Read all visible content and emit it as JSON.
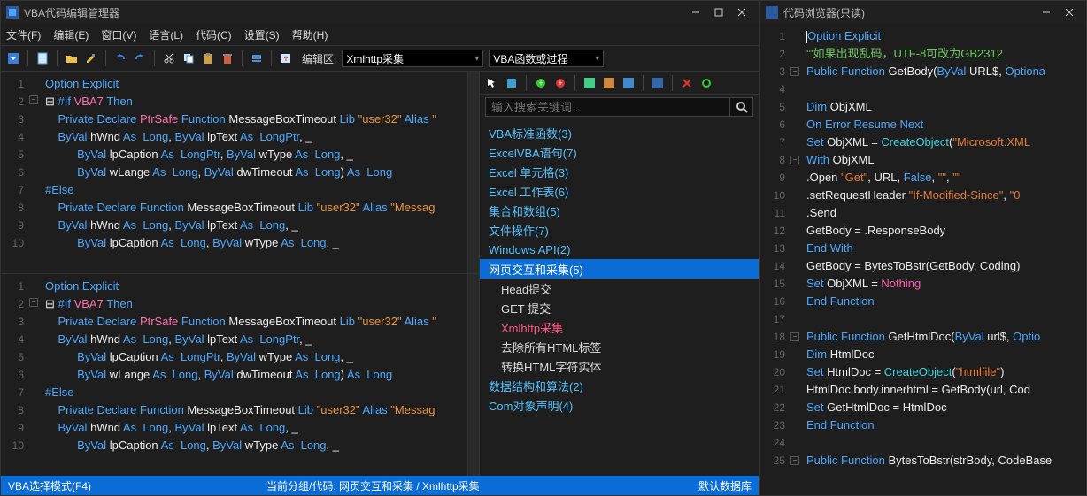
{
  "left": {
    "title": "VBA代码编辑管理器",
    "menu": [
      "文件(F)",
      "编辑(E)",
      "窗口(V)",
      "语言(L)",
      "代码(C)",
      "设置(S)",
      "帮助(H)"
    ],
    "tb_label_area": "编辑区:",
    "combo1": "Xmlhttp采集",
    "combo2": "VBA函数或过程",
    "status_left": "VBA选择模式(F4)",
    "status_mid": "当前分组/代码:  网页交互和采集  /  Xmlhttp采集",
    "status_right": "默认数据库"
  },
  "panel": {
    "search_placeholder": "输入搜索关键词...",
    "tree": [
      {
        "label": "VBA标准函数(3)",
        "sel": false,
        "child": false
      },
      {
        "label": "ExcelVBA语句(7)",
        "sel": false,
        "child": false
      },
      {
        "label": "Excel 单元格(3)",
        "sel": false,
        "child": false
      },
      {
        "label": "Excel 工作表(6)",
        "sel": false,
        "child": false
      },
      {
        "label": "集合和数组(5)",
        "sel": false,
        "child": false
      },
      {
        "label": "文件操作(7)",
        "sel": false,
        "child": false
      },
      {
        "label": "Windows API(2)",
        "sel": false,
        "child": false
      },
      {
        "label": "网页交互和采集(5)",
        "sel": "blue",
        "child": false
      },
      {
        "label": "Head提交",
        "sel": false,
        "child": true
      },
      {
        "label": "GET 提交",
        "sel": false,
        "child": true
      },
      {
        "label": "Xmlhttp采集",
        "sel": "red",
        "child": true
      },
      {
        "label": "去除所有HTML标签",
        "sel": false,
        "child": true
      },
      {
        "label": "转换HTML字符实体",
        "sel": false,
        "child": true
      },
      {
        "label": "数据结构和算法(2)",
        "sel": false,
        "child": false
      },
      {
        "label": "Com对象声明(4)",
        "sel": false,
        "child": false
      }
    ]
  },
  "editor": {
    "gutter": [
      "1",
      "2",
      "3",
      "4",
      "5",
      "6",
      "7",
      "8",
      "9",
      "10"
    ],
    "lines": [
      [
        {
          "t": "Option Explicit",
          "c": "kw-blue"
        }
      ],
      [
        {
          "t": "⊟ ",
          "c": "id"
        },
        {
          "t": "#If ",
          "c": "kw-blue"
        },
        {
          "t": "VBA7 ",
          "c": "kw-pink"
        },
        {
          "t": "Then",
          "c": "kw-blue"
        }
      ],
      [
        {
          "t": "    ",
          "c": ""
        },
        {
          "t": "Private Declare ",
          "c": "kw-blue"
        },
        {
          "t": "PtrSafe ",
          "c": "kw-pink"
        },
        {
          "t": "Function ",
          "c": "kw-blue"
        },
        {
          "t": "MessageBoxTimeout ",
          "c": "id"
        },
        {
          "t": "Lib ",
          "c": "kw-blue"
        },
        {
          "t": "\"user32\" ",
          "c": "kw-orange"
        },
        {
          "t": "Alias ",
          "c": "kw-blue"
        },
        {
          "t": "\"",
          "c": "kw-orange"
        }
      ],
      [
        {
          "t": "    ",
          "c": ""
        },
        {
          "t": "ByVal ",
          "c": "kw-blue"
        },
        {
          "t": "hWnd ",
          "c": "id"
        },
        {
          "t": "As  Long",
          "c": "kw-blue"
        },
        {
          "t": ", ",
          "c": "id"
        },
        {
          "t": "ByVal ",
          "c": "kw-blue"
        },
        {
          "t": "lpText ",
          "c": "id"
        },
        {
          "t": "As  LongPtr",
          "c": "kw-blue"
        },
        {
          "t": ", _",
          "c": "id"
        }
      ],
      [
        {
          "t": "          ",
          "c": ""
        },
        {
          "t": "ByVal ",
          "c": "kw-blue"
        },
        {
          "t": "lpCaption ",
          "c": "id"
        },
        {
          "t": "As  LongPtr",
          "c": "kw-blue"
        },
        {
          "t": ", ",
          "c": "id"
        },
        {
          "t": "ByVal ",
          "c": "kw-blue"
        },
        {
          "t": "wType ",
          "c": "id"
        },
        {
          "t": "As  Long",
          "c": "kw-blue"
        },
        {
          "t": ", _",
          "c": "id"
        }
      ],
      [
        {
          "t": "          ",
          "c": ""
        },
        {
          "t": "ByVal ",
          "c": "kw-blue"
        },
        {
          "t": "wLange ",
          "c": "id"
        },
        {
          "t": "As  Long",
          "c": "kw-blue"
        },
        {
          "t": ", ",
          "c": "id"
        },
        {
          "t": "ByVal ",
          "c": "kw-blue"
        },
        {
          "t": "dwTimeout ",
          "c": "id"
        },
        {
          "t": "As  Long",
          "c": "kw-blue"
        },
        {
          "t": ") ",
          "c": "id"
        },
        {
          "t": "As  Long",
          "c": "kw-blue"
        }
      ],
      [
        {
          "t": "#Else",
          "c": "kw-blue"
        }
      ],
      [
        {
          "t": "    ",
          "c": ""
        },
        {
          "t": "Private Declare Function ",
          "c": "kw-blue"
        },
        {
          "t": "MessageBoxTimeout ",
          "c": "id"
        },
        {
          "t": "Lib ",
          "c": "kw-blue"
        },
        {
          "t": "\"user32\" ",
          "c": "kw-orange"
        },
        {
          "t": "Alias ",
          "c": "kw-blue"
        },
        {
          "t": "\"Messag",
          "c": "kw-orange"
        }
      ],
      [
        {
          "t": "    ",
          "c": ""
        },
        {
          "t": "ByVal ",
          "c": "kw-blue"
        },
        {
          "t": "hWnd ",
          "c": "id"
        },
        {
          "t": "As  Long",
          "c": "kw-blue"
        },
        {
          "t": ", ",
          "c": "id"
        },
        {
          "t": "ByVal ",
          "c": "kw-blue"
        },
        {
          "t": "lpText ",
          "c": "id"
        },
        {
          "t": "As  Long",
          "c": "kw-blue"
        },
        {
          "t": ", _",
          "c": "id"
        }
      ],
      [
        {
          "t": "          ",
          "c": ""
        },
        {
          "t": "ByVal ",
          "c": "kw-blue"
        },
        {
          "t": "lpCaption ",
          "c": "id"
        },
        {
          "t": "As  Long",
          "c": "kw-blue"
        },
        {
          "t": ", ",
          "c": "id"
        },
        {
          "t": "ByVal ",
          "c": "kw-blue"
        },
        {
          "t": "wType ",
          "c": "id"
        },
        {
          "t": "As  Long",
          "c": "kw-blue"
        },
        {
          "t": ", _",
          "c": "id"
        }
      ]
    ]
  },
  "right": {
    "title": "代码浏览器(只读)",
    "gutter": [
      "1",
      "2",
      "3",
      "4",
      "5",
      "6",
      "7",
      "8",
      "9",
      "10",
      "11",
      "12",
      "13",
      "14",
      "15",
      "16",
      "17",
      "18",
      "19",
      "20",
      "21",
      "22",
      "23",
      "24",
      "25"
    ],
    "lines": [
      [
        {
          "t": "Option Explicit",
          "c": "kw-blue"
        }
      ],
      [
        {
          "t": "'''如果出现乱码，UTF-8可改为GB2312",
          "c": "c-comment"
        }
      ],
      [
        {
          "t": "Public Function ",
          "c": "kw-blue"
        },
        {
          "t": "GetBody(",
          "c": "id"
        },
        {
          "t": "ByVal  ",
          "c": "kw-blue"
        },
        {
          "t": "URL$, ",
          "c": "id"
        },
        {
          "t": "Optiona",
          "c": "kw-blue"
        }
      ],
      [
        {
          "t": "",
          "c": ""
        }
      ],
      [
        {
          "t": "    ",
          "c": ""
        },
        {
          "t": "Dim ",
          "c": "kw-blue"
        },
        {
          "t": "ObjXML",
          "c": "id"
        }
      ],
      [
        {
          "t": "    ",
          "c": ""
        },
        {
          "t": "On Error Resume Next",
          "c": "kw-blue"
        }
      ],
      [
        {
          "t": "    ",
          "c": ""
        },
        {
          "t": "Set ",
          "c": "kw-blue"
        },
        {
          "t": "ObjXML = ",
          "c": "id"
        },
        {
          "t": "CreateObject",
          "c": "c-cyan"
        },
        {
          "t": "(",
          "c": "id"
        },
        {
          "t": "\"Microsoft.XML",
          "c": "c-str"
        }
      ],
      [
        {
          "t": "    ",
          "c": ""
        },
        {
          "t": "With ",
          "c": "kw-blue"
        },
        {
          "t": "ObjXML",
          "c": "id"
        }
      ],
      [
        {
          "t": "        .Open ",
          "c": "id"
        },
        {
          "t": "\"Get\"",
          "c": "c-str"
        },
        {
          "t": ", URL, ",
          "c": "id"
        },
        {
          "t": "False",
          "c": "kw-blue"
        },
        {
          "t": ", ",
          "c": "id"
        },
        {
          "t": "\"\"",
          "c": "c-str"
        },
        {
          "t": ", ",
          "c": "id"
        },
        {
          "t": "\"\"",
          "c": "c-str"
        }
      ],
      [
        {
          "t": "        .setRequestHeader ",
          "c": "id"
        },
        {
          "t": "\"If-Modified-Since\"",
          "c": "c-str"
        },
        {
          "t": ", ",
          "c": "id"
        },
        {
          "t": "\"0",
          "c": "c-str"
        }
      ],
      [
        {
          "t": "        .Send",
          "c": "id"
        }
      ],
      [
        {
          "t": "        GetBody = .ResponseBody",
          "c": "id"
        }
      ],
      [
        {
          "t": "    ",
          "c": ""
        },
        {
          "t": "End With",
          "c": "kw-blue"
        }
      ],
      [
        {
          "t": "    GetBody = BytesToBstr(GetBody, Coding)",
          "c": "id"
        }
      ],
      [
        {
          "t": "    ",
          "c": ""
        },
        {
          "t": "Set ",
          "c": "kw-blue"
        },
        {
          "t": "ObjXML = ",
          "c": "id"
        },
        {
          "t": "Nothing",
          "c": "c-pink"
        }
      ],
      [
        {
          "t": "End Function",
          "c": "kw-blue"
        }
      ],
      [
        {
          "t": "",
          "c": ""
        }
      ],
      [
        {
          "t": "Public Function ",
          "c": "kw-blue"
        },
        {
          "t": "GetHtmlDoc(",
          "c": "id"
        },
        {
          "t": "ByVal  ",
          "c": "kw-blue"
        },
        {
          "t": "url$, ",
          "c": "id"
        },
        {
          "t": "Optio",
          "c": "kw-blue"
        }
      ],
      [
        {
          "t": "    ",
          "c": ""
        },
        {
          "t": "Dim ",
          "c": "kw-blue"
        },
        {
          "t": "HtmlDoc",
          "c": "id"
        }
      ],
      [
        {
          "t": "    ",
          "c": ""
        },
        {
          "t": "Set ",
          "c": "kw-blue"
        },
        {
          "t": "HtmlDoc = ",
          "c": "id"
        },
        {
          "t": "CreateObject",
          "c": "c-cyan"
        },
        {
          "t": "(",
          "c": "id"
        },
        {
          "t": "\"htmlfile\"",
          "c": "c-str"
        },
        {
          "t": ")",
          "c": "id"
        }
      ],
      [
        {
          "t": "    HtmlDoc.body.innerhtml = GetBody(url, Cod",
          "c": "id"
        }
      ],
      [
        {
          "t": "    ",
          "c": ""
        },
        {
          "t": "Set ",
          "c": "kw-blue"
        },
        {
          "t": "GetHtmlDoc = HtmlDoc",
          "c": "id"
        }
      ],
      [
        {
          "t": "End Function",
          "c": "kw-blue"
        }
      ],
      [
        {
          "t": "",
          "c": ""
        }
      ],
      [
        {
          "t": "Public Function ",
          "c": "kw-blue"
        },
        {
          "t": "BytesToBstr(strBody, CodeBase",
          "c": "id"
        }
      ]
    ],
    "folds": [
      {
        "row": 3,
        "sym": "−"
      },
      {
        "row": 8,
        "sym": "−"
      },
      {
        "row": 18,
        "sym": "−"
      },
      {
        "row": 25,
        "sym": "−"
      }
    ]
  }
}
